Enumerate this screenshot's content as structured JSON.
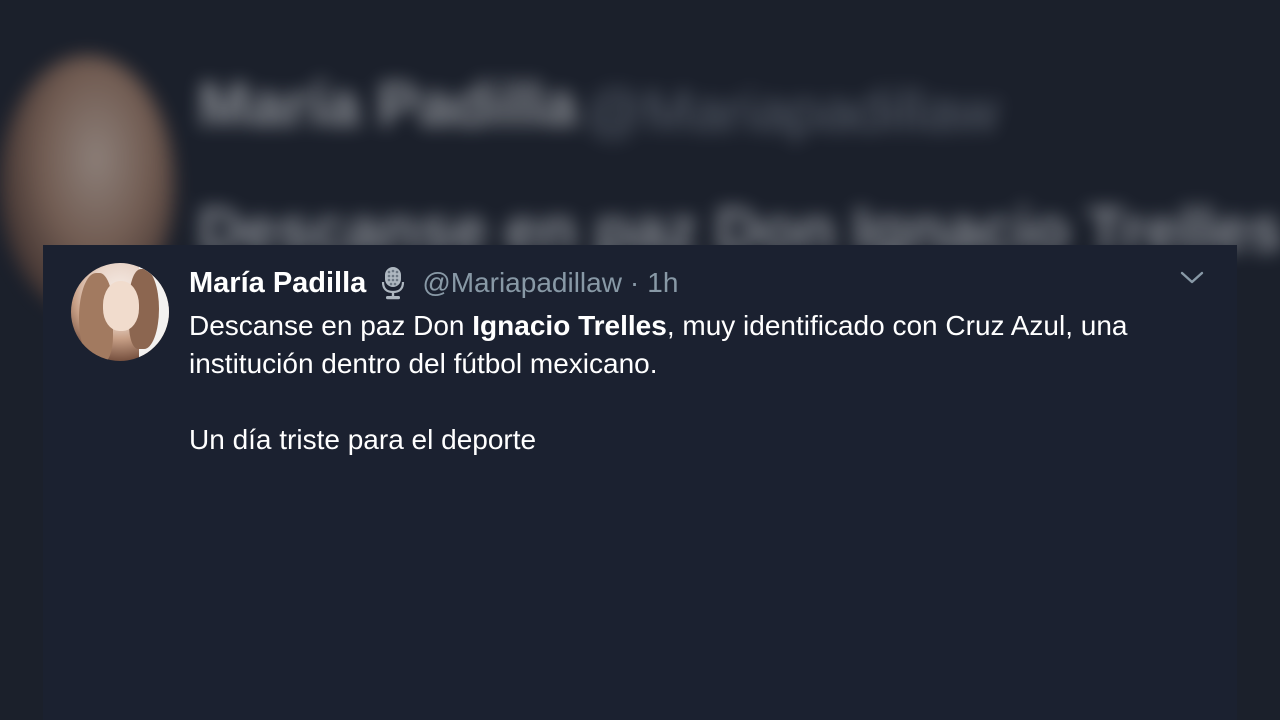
{
  "tweet": {
    "author_name": "María Padilla",
    "handle": "@Mariapadillaw",
    "separator": "·",
    "time": "1h",
    "text_line1_a": "Descanse en paz Don ",
    "text_line1_bold": "Ignacio Trelles",
    "text_line1_b": ", muy identificado con Cruz Azul, una",
    "text_line2": "institución dentro del fútbol mexicano.",
    "text_line3": "Un día triste para el deporte"
  },
  "icons": {
    "badge": "microphone-icon",
    "menu": "chevron-down-icon",
    "avatar": "avatar"
  },
  "colors": {
    "background": "#1b202b",
    "card": "#1b2130",
    "text": "#ffffff",
    "muted": "#8899a6"
  }
}
